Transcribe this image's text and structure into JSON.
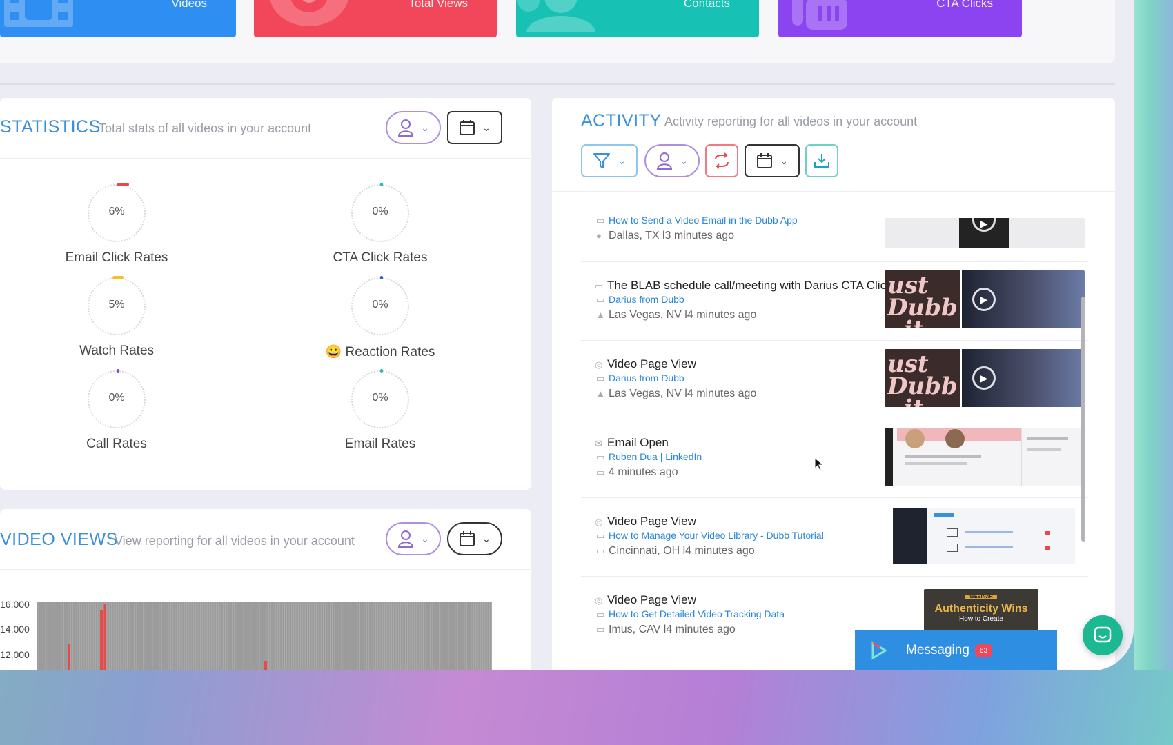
{
  "kpis": [
    {
      "label": "Videos",
      "color": "#2f8ef2",
      "icon": "film-icon"
    },
    {
      "label": "Total Views",
      "color": "#f2475a",
      "icon": "eye-icon"
    },
    {
      "label": "Contacts",
      "color": "#17c2b5",
      "icon": "users-icon"
    },
    {
      "label": "CTA Clicks",
      "color": "#8b44f0",
      "icon": "hand-pointer-icon"
    }
  ],
  "statistics": {
    "title": "STATISTICS",
    "subtitle": "Total stats of all videos in your account",
    "gauges": [
      {
        "value": "6%",
        "label": "Email Click Rates",
        "accent": "#e8474e",
        "progress": 0.06
      },
      {
        "value": "0%",
        "label": "CTA Click Rates",
        "accent": "#17c2b5",
        "progress": 0
      },
      {
        "value": "5%",
        "label": "Watch Rates",
        "accent": "#f2c12e",
        "progress": 0.05
      },
      {
        "value": "0%",
        "label": "Reaction Rates",
        "emoji": "😀",
        "accent": "#2f5fc0",
        "progress": 0
      },
      {
        "value": "0%",
        "label": "Call Rates",
        "accent": "#8b44f0",
        "progress": 0
      },
      {
        "value": "0%",
        "label": "Email Rates",
        "accent": "#17c2b5",
        "progress": 0
      }
    ]
  },
  "video_views": {
    "title": "VIDEO VIEWS",
    "subtitle": "View reporting for all videos in your account",
    "y_ticks": [
      "16,000",
      "14,000",
      "12,000"
    ]
  },
  "activity": {
    "title": "ACTIVITY",
    "subtitle": "Activity reporting for all videos in your account",
    "rows": [
      {
        "title": "",
        "link": "How to Send a Video Email in the Dubb App",
        "meta": "Dallas, TX l3 minutes ago",
        "type_icon": "video-icon",
        "meta_icon": "apple-icon",
        "thumb": "dark-video"
      },
      {
        "title": "The BLAB schedule call/meeting with Darius CTA Click",
        "link": "Darius from Dubb",
        "meta": "Las Vegas, NV l4 minutes ago",
        "type_icon": "cta-icon",
        "meta_icon": "android-icon",
        "thumb": "dubb-it"
      },
      {
        "title": "Video Page View",
        "link": "Darius from Dubb",
        "meta": "Las Vegas, NV l4 minutes ago",
        "type_icon": "eye-icon",
        "meta_icon": "android-icon",
        "thumb": "dubb-it"
      },
      {
        "title": "Email Open",
        "link": "Ruben Dua | LinkedIn",
        "meta": "4 minutes ago",
        "type_icon": "envelope-icon",
        "meta_icon": "desktop-icon",
        "thumb": "linkedin"
      },
      {
        "title": "Video Page View",
        "link": "How to Manage Your Video Library - Dubb Tutorial",
        "meta": "Cincinnati, OH l4 minutes ago",
        "type_icon": "eye-icon",
        "meta_icon": "desktop-icon",
        "thumb": "library"
      },
      {
        "title": "Video Page View",
        "link": "How to Get Detailed Video Tracking Data",
        "meta": "Imus, CAV l4 minutes ago",
        "type_icon": "eye-icon",
        "meta_icon": "desktop-icon",
        "thumb": "webinar"
      }
    ],
    "webinar_thumb": {
      "badge": "WEBINAR",
      "headline": "Authenticity Wins",
      "sub": "How to Create"
    }
  },
  "messaging": {
    "label": "Messaging",
    "badge": "63"
  },
  "colors": {
    "accent_blue": "#3a90dd",
    "purple": "#b08ee0",
    "teal": "#17c2b5",
    "red": "#f2475a"
  }
}
